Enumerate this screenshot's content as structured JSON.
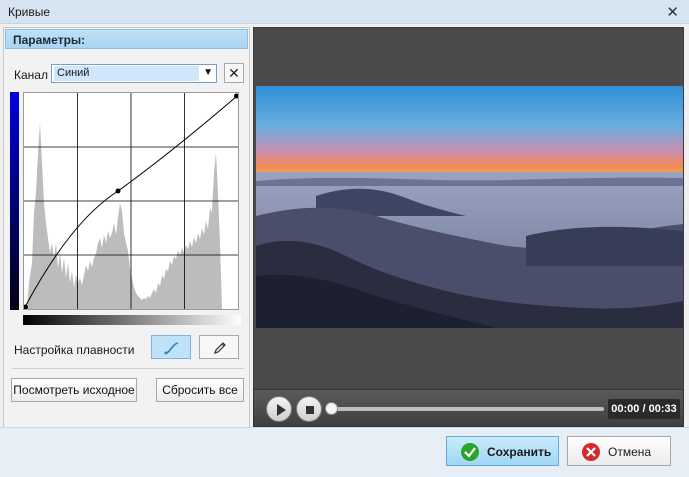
{
  "window": {
    "title": "Кривые"
  },
  "panel": {
    "header": "Параметры:"
  },
  "channel": {
    "label": "Канал",
    "selected": "Синий",
    "options": [
      "Синий"
    ]
  },
  "smoothness": {
    "label": "Настройка плавности"
  },
  "buttons": {
    "view_original": "Посмотреть исходное",
    "reset_all": "Сбросить все",
    "save": "Сохранить",
    "cancel": "Отмена"
  },
  "player": {
    "time": "00:00 / 00:33",
    "progress": 0
  },
  "colors": {
    "channel_blue": "#0000e0",
    "accent": "#a8d3f1",
    "save_green": "#2aa52a",
    "cancel_red": "#d32b2b"
  },
  "icons": {
    "close": "close-icon",
    "play": "play-icon",
    "stop": "stop-icon",
    "smooth": "smooth-curve-icon",
    "pencil": "pencil-icon"
  }
}
